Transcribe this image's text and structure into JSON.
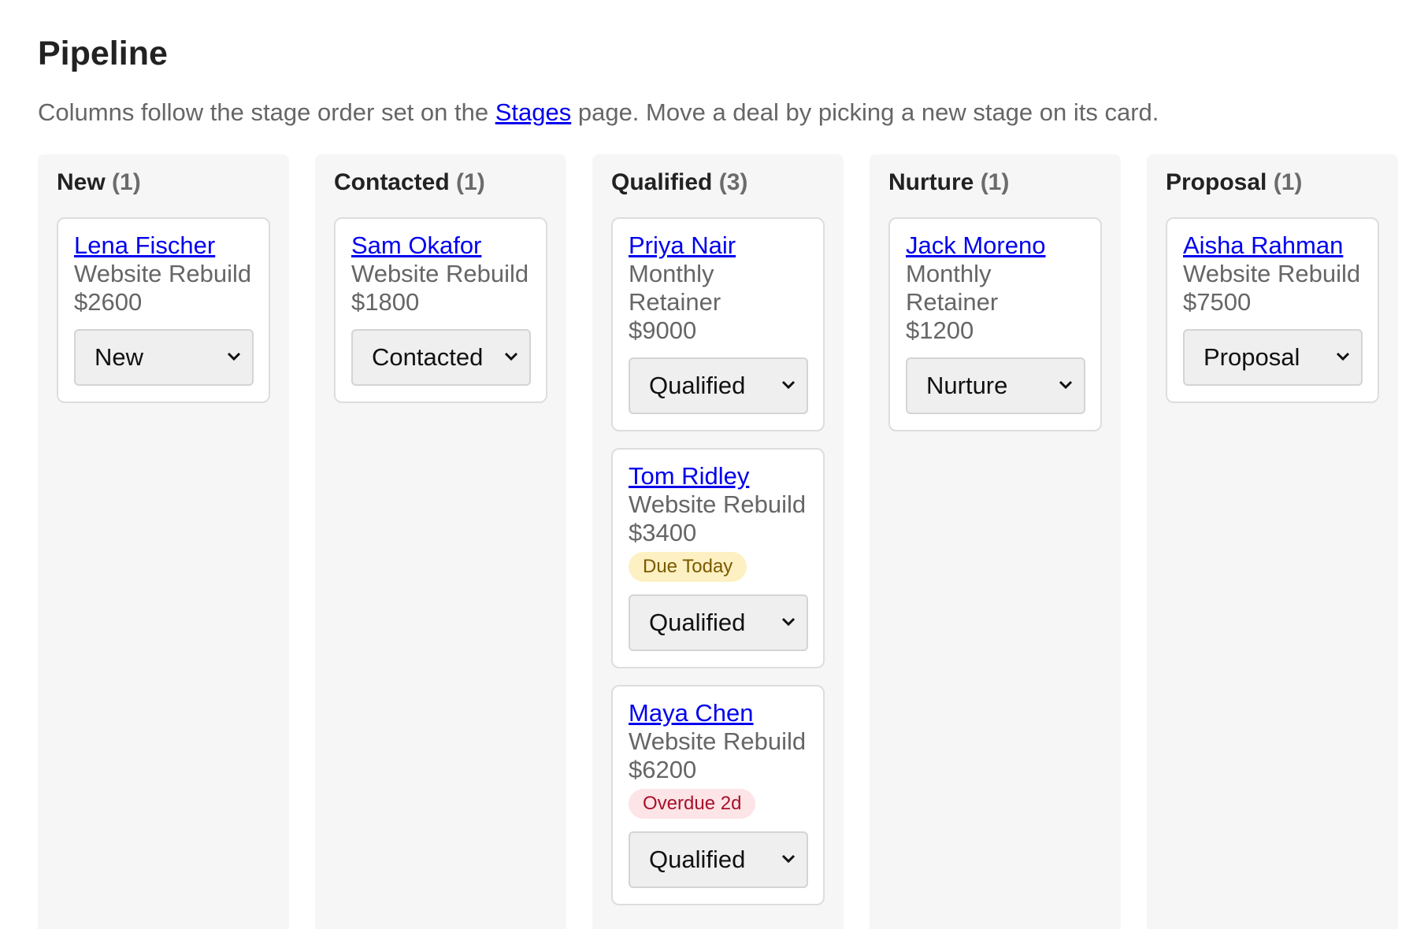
{
  "page": {
    "title": "Pipeline",
    "subtitle_before": "Columns follow the stage order set on the ",
    "subtitle_link": "Stages",
    "subtitle_after": " page. Move a deal by picking a new stage on its card."
  },
  "columns": [
    {
      "name": "New",
      "count": "(1)",
      "cards": [
        {
          "name": "Lena Fischer",
          "service": "Website Rebuild",
          "value": "$2600",
          "stage": "New"
        }
      ]
    },
    {
      "name": "Contacted",
      "count": "(1)",
      "cards": [
        {
          "name": "Sam Okafor",
          "service": "Website Rebuild",
          "value": "$1800",
          "stage": "Contacted"
        }
      ]
    },
    {
      "name": "Qualified",
      "count": "(3)",
      "cards": [
        {
          "name": "Priya Nair",
          "service": "Monthly Retainer",
          "value": "$9000",
          "stage": "Qualified"
        },
        {
          "name": "Tom Ridley",
          "service": "Website Rebuild",
          "value": "$3400",
          "badge": "Due Today",
          "stage": "Qualified"
        },
        {
          "name": "Maya Chen",
          "service": "Website Rebuild",
          "value": "$6200",
          "badge": "Overdue 2d",
          "stage": "Qualified"
        }
      ]
    },
    {
      "name": "Nurture",
      "count": "(1)",
      "cards": [
        {
          "name": "Jack Moreno",
          "service": "Monthly Retainer",
          "value": "$1200",
          "stage": "Nurture"
        }
      ]
    },
    {
      "name": "Proposal",
      "count": "(1)",
      "cards": [
        {
          "name": "Aisha Rahman",
          "service": "Website Rebuild",
          "value": "$7500",
          "stage": "Proposal"
        }
      ]
    }
  ],
  "colors": {
    "link": "#0000ee",
    "column_bg": "#f6f6f6",
    "badge_warning_bg": "#fdf0c2",
    "badge_warning_text": "#7a5a00",
    "badge_danger_bg": "#fde4e6",
    "badge_danger_text": "#a8102a"
  },
  "icons": {
    "select": "chevron-down-icon"
  }
}
